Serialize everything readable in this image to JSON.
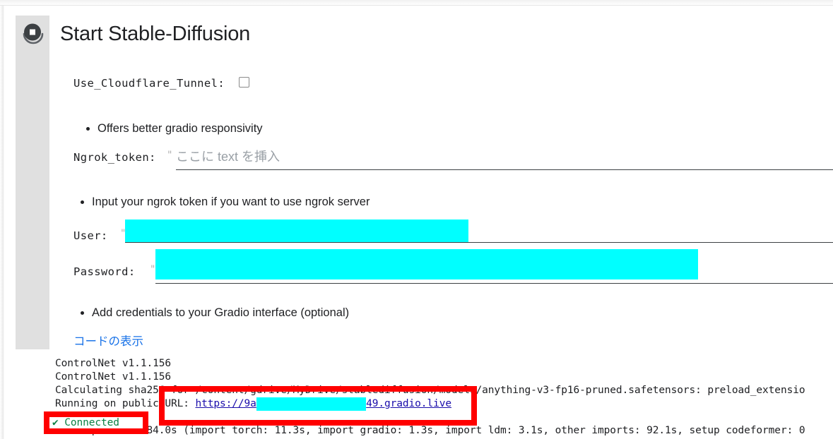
{
  "notebook": {
    "cell": {
      "run_button_icon": "stop-circle-icon",
      "title": "Start Stable-Diffusion",
      "show_code_link": "コードの表示"
    },
    "form": {
      "cloudflare": {
        "label": "Use_Cloudflare_Tunnel:",
        "checked": false,
        "hint": "Offers better gradio responsivity"
      },
      "ngrok": {
        "label": "Ngrok_token:",
        "quote": "\"",
        "placeholder": "ここに text を挿入",
        "value": "",
        "hint": "Input your ngrok token if you want to use ngrok server"
      },
      "user": {
        "label": "User:",
        "quote": "\"",
        "value": "",
        "redacted": true
      },
      "password": {
        "label": "Password:",
        "quote": "\"",
        "value": "",
        "redacted": true,
        "hint": "Add credentials to your Gradio interface (optional)"
      }
    },
    "output": {
      "lines": [
        "ControlNet v1.1.156",
        "ControlNet v1.1.156",
        "Calculating sha256 for /content/gdrive/MyDrive/stablediffusion/models/anything-v3-fp16-pruned.safetensors: preload_extensio",
        "Running on public URL: https://9a                    49.gradio.live",
        "Startup time: 184.0s (import torch: 11.3s, import gradio: 1.3s, import ldm: 3.1s, other imports: 92.1s, setup codeformer: 0"
      ],
      "url_line": {
        "prefix": "Running on public URL: ",
        "link_start": "https://9a",
        "link_redacted": "                  ",
        "link_end": "49.gradio.live"
      },
      "connected_status": "✔ Connected"
    },
    "annotations": {
      "color": "#ff0000",
      "boxes": [
        "url-highlight",
        "connected-highlight"
      ]
    },
    "colors": {
      "redaction": "#00ffff",
      "link": "#1a73e8",
      "terminal_link": "#1a0dab",
      "success": "#0b8043",
      "annotation": "#ff0000",
      "gutter": "#e0e0e0"
    }
  }
}
